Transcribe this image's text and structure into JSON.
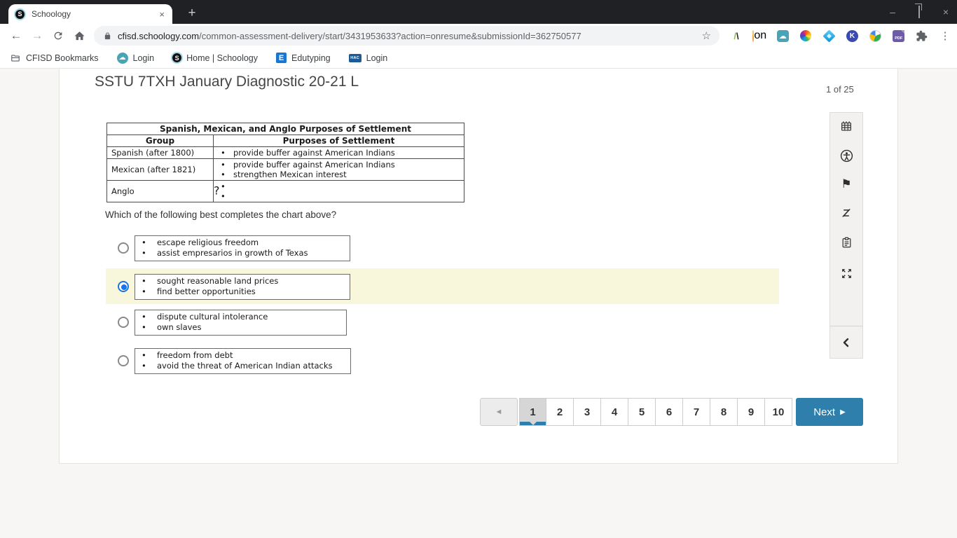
{
  "browser": {
    "tab_title": "Schoology",
    "url_host": "cfisd.schoology.com",
    "url_path": "/common-assessment-delivery/start/3431953633?action=onresume&submissionId=362750577",
    "window": {
      "minimize": "–",
      "close": "×",
      "tab_close": "×",
      "new_tab": "+"
    },
    "nav": {
      "back": "←",
      "forward": "→",
      "star": "☆",
      "menu_dots": "⋮"
    },
    "bookmarks": [
      {
        "label": "CFISD Bookmarks"
      },
      {
        "label": "Login"
      },
      {
        "label": "Home | Schoology"
      },
      {
        "label": "Edutyping"
      },
      {
        "label": "Login"
      }
    ],
    "bookmark_icon_text": {
      "schoology_letter": "S",
      "cloud": "☁",
      "edutyping_letter": "E",
      "hac": "HAC"
    },
    "extensions": {
      "slash_green": "/",
      "slash_black": "\\",
      "on_badge": "on",
      "cloud": "☁",
      "kami_letter": "K",
      "pdf_label": "PDF"
    }
  },
  "assessment": {
    "title": "SSTU 7TXH January Diagnostic 20-21 L",
    "progress": "1 of 25",
    "chart": {
      "title": "Spanish, Mexican, and Anglo Purposes of Settlement",
      "columns": [
        "Group",
        "Purposes of Settlement"
      ],
      "rows": [
        {
          "group": "Spanish (after 1800)",
          "purposes": [
            "provide buffer against American Indians"
          ]
        },
        {
          "group": "Mexican (after 1821)",
          "purposes": [
            "provide buffer against American Indians",
            "strengthen Mexican interest"
          ]
        },
        {
          "group": "Anglo",
          "purposes": [],
          "placeholder": "?"
        }
      ]
    },
    "question": "Which of the following best completes the chart above?",
    "bullet_glyph": "•",
    "options": [
      {
        "selected": false,
        "bullets": [
          "escape religious freedom",
          "assist empresarios in growth of Texas"
        ]
      },
      {
        "selected": true,
        "bullets": [
          "sought reasonable land prices",
          "find better opportunities"
        ]
      },
      {
        "selected": false,
        "bullets": [
          "dispute cultural intolerance",
          "own slaves"
        ]
      },
      {
        "selected": false,
        "bullets": [
          "freedom from debt",
          "avoid the threat of American Indian attacks"
        ]
      }
    ],
    "pagination": {
      "prev_arrow": "◄",
      "pages": [
        "1",
        "2",
        "3",
        "4",
        "5",
        "6",
        "7",
        "8",
        "9",
        "10"
      ],
      "active_page": "1",
      "next_label": "Next",
      "next_arrow": "▶"
    }
  },
  "colors": {
    "accent_blue": "#2e7fac",
    "highlight_yellow": "#f8f7dc",
    "radio_blue": "#1a73e8",
    "frame_dark": "#202124"
  }
}
